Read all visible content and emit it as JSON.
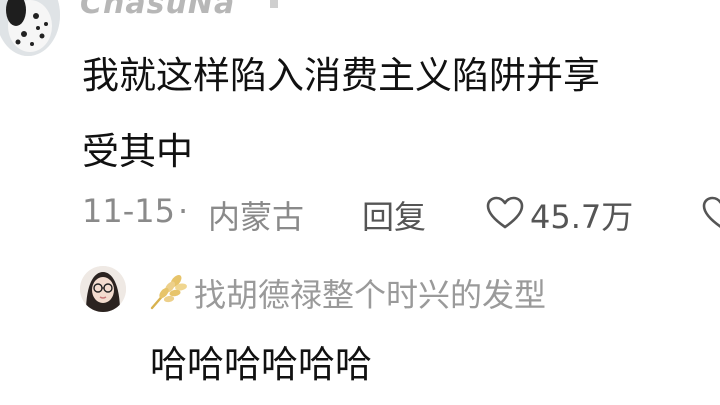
{
  "comment": {
    "username": "ChasuNa",
    "text_line1": "我就这样陷入消费主义陷阱并享",
    "text_line2": "受其中",
    "date": "11-15",
    "separator": "·",
    "location": "内蒙古",
    "reply_label": "回复",
    "like_count": "45.7万"
  },
  "reply": {
    "username": "找胡德禄整个时兴的发型",
    "text": "哈哈哈哈哈哈"
  },
  "colors": {
    "primary_text": "#111111",
    "secondary_text": "#8a8a8a",
    "badge_wheat": "#e7c46a"
  },
  "icons": {
    "like": "heart-outline-icon",
    "badge": "wheat-badge-icon"
  }
}
